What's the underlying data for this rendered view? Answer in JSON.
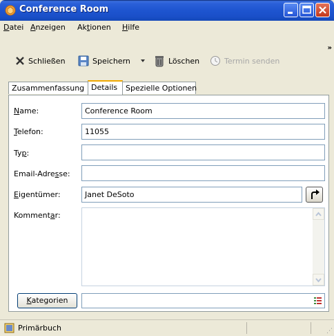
{
  "window": {
    "title": "Conference Room"
  },
  "menu": [
    {
      "pre": "",
      "ul": "D",
      "post": "atei"
    },
    {
      "pre": "",
      "ul": "A",
      "post": "nzeigen"
    },
    {
      "pre": "Ak",
      "ul": "t",
      "post": "ionen"
    },
    {
      "pre": "",
      "ul": "H",
      "post": "ilfe"
    }
  ],
  "toolbar": {
    "close_label": "Schließen",
    "save_label": "Speichern",
    "delete_label": "Löschen",
    "send_label": "Termin senden",
    "overflow": "»"
  },
  "tabs": [
    "Zusammenfassung",
    "Details",
    "Spezielle Optionen"
  ],
  "form": {
    "name_label": {
      "ul": "N",
      "post": "ame:"
    },
    "name_value": "Conference Room",
    "phone_label": {
      "ul": "T",
      "post": "elefon:"
    },
    "phone_value": "11055",
    "type_label": {
      "pre": "Ty",
      "ul": "p",
      "post": ":"
    },
    "type_value": "",
    "email_label": {
      "pre": "Email-Adre",
      "ul": "s",
      "post": "se:"
    },
    "email_value": "",
    "owner_label": {
      "ul": "E",
      "post": "igentümer:"
    },
    "owner_value": "Janet DeSoto",
    "comment_label": {
      "pre": "Komment",
      "ul": "a",
      "post": "r:"
    },
    "comment_value": "",
    "categories_button": {
      "ul": "K",
      "post": "ategorien"
    },
    "categories_value": ""
  },
  "status": {
    "text": "Primärbuch"
  },
  "colors": {
    "titlebar": "#1E55D0",
    "tab_accent": "#F0A800",
    "field_border": "#7F9DB9"
  }
}
